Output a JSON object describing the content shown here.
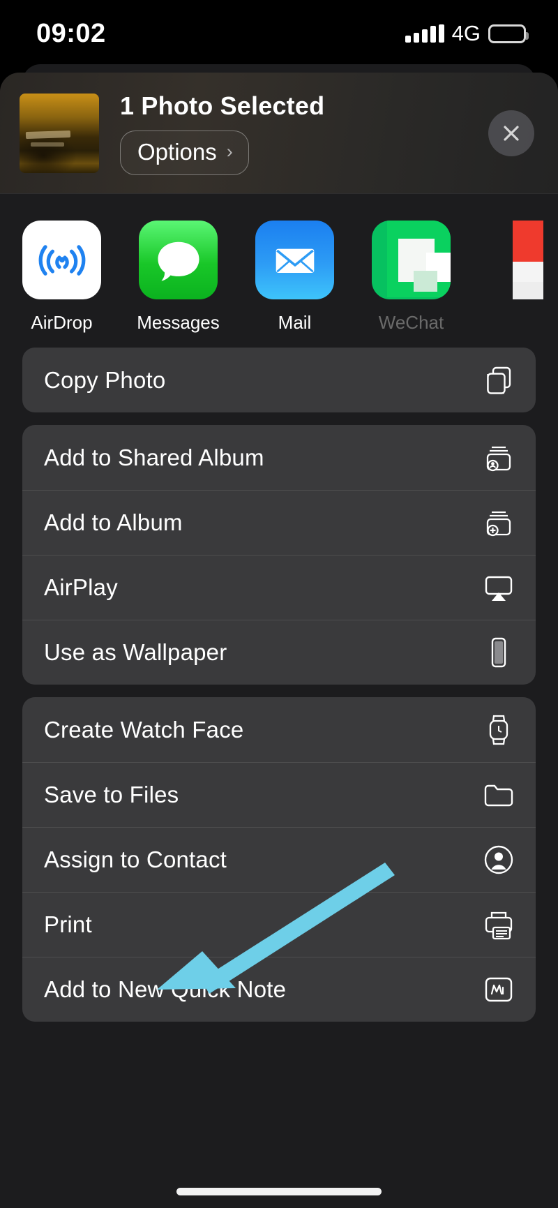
{
  "status_bar": {
    "time": "09:02",
    "network": "4G",
    "signal_icon": "signal-bars-icon",
    "battery_icon": "battery-icon"
  },
  "header": {
    "thumbnail_alt": "selected-photo-thumbnail",
    "title": "1 Photo Selected",
    "options_label": "Options",
    "options_chevron": "›",
    "close_icon": "close-icon"
  },
  "apps": [
    {
      "label": "AirDrop",
      "icon": "airdrop-icon"
    },
    {
      "label": "Messages",
      "icon": "messages-icon"
    },
    {
      "label": "Mail",
      "icon": "mail-icon"
    },
    {
      "label": "WeChat",
      "icon": "wechat-icon"
    },
    {
      "label": "",
      "icon": "partial-app-icon"
    }
  ],
  "action_groups": [
    {
      "rows": [
        {
          "label": "Copy Photo",
          "icon": "copy-icon"
        }
      ]
    },
    {
      "rows": [
        {
          "label": "Add to Shared Album",
          "icon": "shared-album-icon"
        },
        {
          "label": "Add to Album",
          "icon": "add-album-icon"
        },
        {
          "label": "AirPlay",
          "icon": "airplay-icon"
        },
        {
          "label": "Use as Wallpaper",
          "icon": "wallpaper-icon"
        }
      ]
    },
    {
      "rows": [
        {
          "label": "Create Watch Face",
          "icon": "watch-icon"
        },
        {
          "label": "Save to Files",
          "icon": "folder-icon"
        },
        {
          "label": "Assign to Contact",
          "icon": "contact-icon"
        },
        {
          "label": "Print",
          "icon": "printer-icon"
        },
        {
          "label": "Add to New Quick Note",
          "icon": "quick-note-icon"
        }
      ]
    }
  ],
  "annotation": {
    "type": "arrow",
    "color": "#6ecfe8",
    "points_to": "Print"
  },
  "colors": {
    "sheet_background": "#1c1c1e",
    "card_background": "#3a3a3c",
    "text_primary": "#ffffff",
    "accent_arrow": "#6ecfe8",
    "messages_green": "#19c728",
    "mail_blue": "#2d9cf5",
    "wechat_green": "#07c160"
  },
  "home_indicator": "home-indicator"
}
